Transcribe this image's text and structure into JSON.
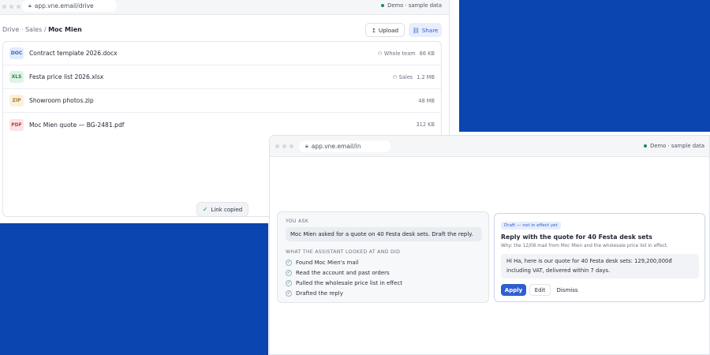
{
  "colors": {
    "accent": "#2f5fd0",
    "brand_blue": "#0a45b0",
    "status_green": "#1f8a4c"
  },
  "drive": {
    "url": "app.vne.email/drive",
    "demo_label": "Demo · sample data",
    "breadcrumb": {
      "root": "Drive",
      "sep1": "·",
      "folder": "Sales",
      "sep2": "/",
      "current": "Moc Mien"
    },
    "upload_label": "Upload",
    "share_label": "Share",
    "files": [
      {
        "type": "DOC",
        "name": "Contract template 2026.docx",
        "shared": "Whole team",
        "size": "86 KB"
      },
      {
        "type": "XLS",
        "name": "Festa price list 2026.xlsx",
        "shared": "Sales",
        "size": "1.2 MB"
      },
      {
        "type": "ZIP",
        "name": "Showroom photos.zip",
        "shared": "",
        "size": "48 MB"
      },
      {
        "type": "PDF",
        "name": "Moc Mien quote — BG-2481.pdf",
        "shared": "",
        "size": "312 KB"
      }
    ],
    "toast": "Link copied"
  },
  "assistant": {
    "url": "app.vne.email/in",
    "demo_label": "Demo · sample data",
    "you_ask_label": "YOU ASK",
    "ask_text": "Moc Mien asked for a quote on 40 Festa desk sets. Draft the reply.",
    "looked_label": "WHAT THE ASSISTANT LOOKED AT AND DID",
    "steps": [
      "Found Moc Mien's mail",
      "Read the account and past orders",
      "Pulled the wholesale price list in effect",
      "Drafted the reply"
    ],
    "draft": {
      "badge": "Draft — not in effect yet",
      "title": "Reply with the quote for 40 Festa desk sets",
      "why": "Why: the 12/08 mail from Moc Mien and the wholesale price list in effect.",
      "body": "Hi Ha, here is our quote for 40 Festa desk sets: 129,200,000đ including VAT, delivered within 7 days.",
      "apply_label": "Apply",
      "edit_label": "Edit",
      "dismiss_label": "Dismiss"
    }
  }
}
